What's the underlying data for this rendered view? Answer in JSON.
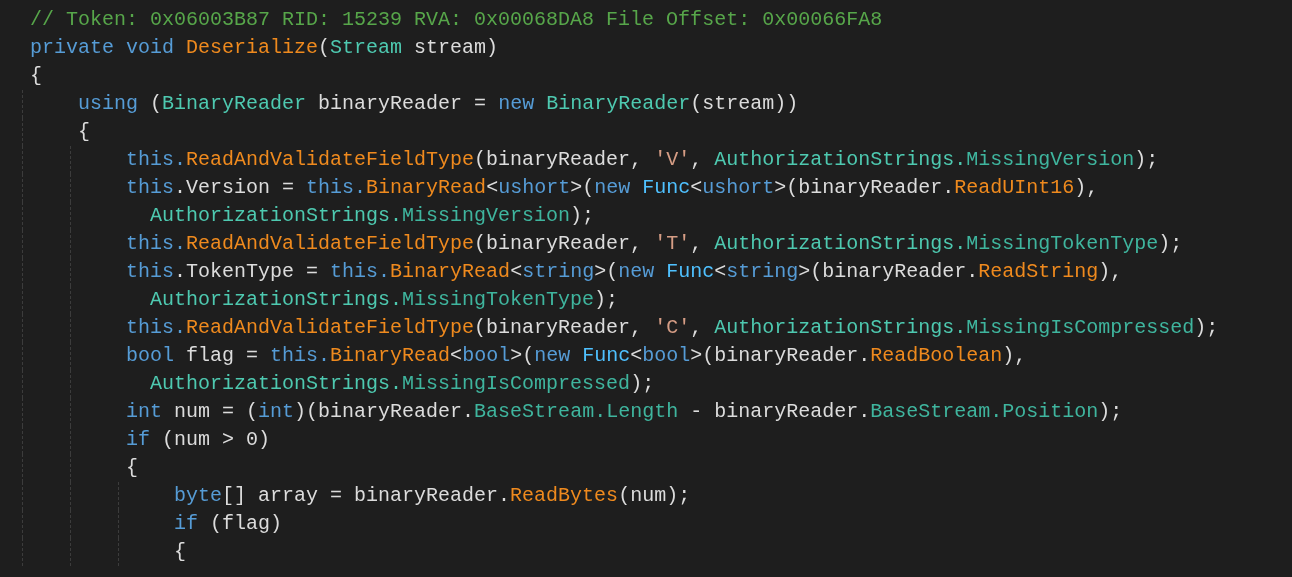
{
  "code_lines": [
    {
      "tokens": [
        {
          "text": "// Token: 0x06003B87 RID: 15239 RVA: 0x00068DA8 File Offset: 0x00066FA8",
          "kind": "comment"
        }
      ]
    },
    {
      "tokens": [
        {
          "text": "private void ",
          "kind": "keyword"
        },
        {
          "text": "Deserialize",
          "kind": "method"
        },
        {
          "text": "(",
          "kind": "plain"
        },
        {
          "text": "Stream",
          "kind": "type"
        },
        {
          "text": " stream)",
          "kind": "plain"
        }
      ]
    },
    {
      "tokens": [
        {
          "text": "{",
          "kind": "plain"
        }
      ]
    },
    {
      "tokens": [
        {
          "text": "    using",
          "kind": "keyword"
        },
        {
          "text": " (",
          "kind": "plain"
        },
        {
          "text": "BinaryReader",
          "kind": "type"
        },
        {
          "text": " binaryReader = ",
          "kind": "plain"
        },
        {
          "text": "new ",
          "kind": "keyword"
        },
        {
          "text": "BinaryReader",
          "kind": "type"
        },
        {
          "text": "(stream))",
          "kind": "plain"
        }
      ]
    },
    {
      "tokens": [
        {
          "text": "    {",
          "kind": "plain"
        }
      ]
    },
    {
      "tokens": [
        {
          "text": "        this.",
          "kind": "keyword"
        },
        {
          "text": "ReadAndValidateFieldType",
          "kind": "method"
        },
        {
          "text": "(binaryReader, ",
          "kind": "plain"
        },
        {
          "text": "'V'",
          "kind": "char"
        },
        {
          "text": ", ",
          "kind": "plain"
        },
        {
          "text": "AuthorizationStrings.",
          "kind": "type"
        },
        {
          "text": "MissingVersion",
          "kind": "member"
        },
        {
          "text": ");",
          "kind": "plain"
        }
      ]
    },
    {
      "tokens": [
        {
          "text": "        this",
          "kind": "keyword"
        },
        {
          "text": ".Version = ",
          "kind": "plain"
        },
        {
          "text": "this.",
          "kind": "keyword"
        },
        {
          "text": "BinaryRead",
          "kind": "method"
        },
        {
          "text": "<",
          "kind": "plain"
        },
        {
          "text": "ushort",
          "kind": "keyword"
        },
        {
          "text": ">(",
          "kind": "plain"
        },
        {
          "text": "new ",
          "kind": "keyword"
        },
        {
          "text": "Func",
          "kind": "delegate"
        },
        {
          "text": "<",
          "kind": "plain"
        },
        {
          "text": "ushort",
          "kind": "keyword"
        },
        {
          "text": ">(binaryReader.",
          "kind": "plain"
        },
        {
          "text": "ReadUInt16",
          "kind": "method"
        },
        {
          "text": "),",
          "kind": "plain"
        }
      ]
    },
    {
      "tokens": [
        {
          "text": "          AuthorizationStrings.",
          "kind": "type"
        },
        {
          "text": "MissingVersion",
          "kind": "member"
        },
        {
          "text": ");",
          "kind": "plain"
        }
      ]
    },
    {
      "tokens": [
        {
          "text": "        this.",
          "kind": "keyword"
        },
        {
          "text": "ReadAndValidateFieldType",
          "kind": "method"
        },
        {
          "text": "(binaryReader, ",
          "kind": "plain"
        },
        {
          "text": "'T'",
          "kind": "char"
        },
        {
          "text": ", ",
          "kind": "plain"
        },
        {
          "text": "AuthorizationStrings.",
          "kind": "type"
        },
        {
          "text": "MissingTokenType",
          "kind": "member"
        },
        {
          "text": ");",
          "kind": "plain"
        }
      ]
    },
    {
      "tokens": [
        {
          "text": "        this",
          "kind": "keyword"
        },
        {
          "text": ".TokenType = ",
          "kind": "plain"
        },
        {
          "text": "this.",
          "kind": "keyword"
        },
        {
          "text": "BinaryRead",
          "kind": "method"
        },
        {
          "text": "<",
          "kind": "plain"
        },
        {
          "text": "string",
          "kind": "keyword"
        },
        {
          "text": ">(",
          "kind": "plain"
        },
        {
          "text": "new ",
          "kind": "keyword"
        },
        {
          "text": "Func",
          "kind": "delegate"
        },
        {
          "text": "<",
          "kind": "plain"
        },
        {
          "text": "string",
          "kind": "keyword"
        },
        {
          "text": ">(binaryReader.",
          "kind": "plain"
        },
        {
          "text": "ReadString",
          "kind": "method"
        },
        {
          "text": "),",
          "kind": "plain"
        }
      ]
    },
    {
      "tokens": [
        {
          "text": "          AuthorizationStrings.",
          "kind": "type"
        },
        {
          "text": "MissingTokenType",
          "kind": "member"
        },
        {
          "text": ");",
          "kind": "plain"
        }
      ]
    },
    {
      "tokens": [
        {
          "text": "        this.",
          "kind": "keyword"
        },
        {
          "text": "ReadAndValidateFieldType",
          "kind": "method"
        },
        {
          "text": "(binaryReader, ",
          "kind": "plain"
        },
        {
          "text": "'C'",
          "kind": "char"
        },
        {
          "text": ", ",
          "kind": "plain"
        },
        {
          "text": "AuthorizationStrings.",
          "kind": "type"
        },
        {
          "text": "MissingIsCompressed",
          "kind": "member"
        },
        {
          "text": ");",
          "kind": "plain"
        }
      ]
    },
    {
      "tokens": [
        {
          "text": "        bool",
          "kind": "keyword"
        },
        {
          "text": " flag = ",
          "kind": "plain"
        },
        {
          "text": "this.",
          "kind": "keyword"
        },
        {
          "text": "BinaryRead",
          "kind": "method"
        },
        {
          "text": "<",
          "kind": "plain"
        },
        {
          "text": "bool",
          "kind": "keyword"
        },
        {
          "text": ">(",
          "kind": "plain"
        },
        {
          "text": "new ",
          "kind": "keyword"
        },
        {
          "text": "Func",
          "kind": "delegate"
        },
        {
          "text": "<",
          "kind": "plain"
        },
        {
          "text": "bool",
          "kind": "keyword"
        },
        {
          "text": ">(binaryReader.",
          "kind": "plain"
        },
        {
          "text": "ReadBoolean",
          "kind": "method"
        },
        {
          "text": "),",
          "kind": "plain"
        }
      ]
    },
    {
      "tokens": [
        {
          "text": "          AuthorizationStrings.",
          "kind": "type"
        },
        {
          "text": "MissingIsCompressed",
          "kind": "member"
        },
        {
          "text": ");",
          "kind": "plain"
        }
      ]
    },
    {
      "tokens": [
        {
          "text": "        int",
          "kind": "keyword"
        },
        {
          "text": " num = (",
          "kind": "plain"
        },
        {
          "text": "int",
          "kind": "keyword"
        },
        {
          "text": ")(binaryReader.",
          "kind": "plain"
        },
        {
          "text": "BaseStream.",
          "kind": "member"
        },
        {
          "text": "Length",
          "kind": "member"
        },
        {
          "text": " - binaryReader.",
          "kind": "plain"
        },
        {
          "text": "BaseStream.",
          "kind": "member"
        },
        {
          "text": "Position",
          "kind": "member"
        },
        {
          "text": ");",
          "kind": "plain"
        }
      ]
    },
    {
      "tokens": [
        {
          "text": "        if",
          "kind": "keyword"
        },
        {
          "text": " (num > 0)",
          "kind": "plain"
        }
      ]
    },
    {
      "tokens": [
        {
          "text": "        {",
          "kind": "plain"
        }
      ]
    },
    {
      "tokens": [
        {
          "text": "            byte",
          "kind": "keyword"
        },
        {
          "text": "[] array = binaryReader.",
          "kind": "plain"
        },
        {
          "text": "ReadBytes",
          "kind": "method"
        },
        {
          "text": "(num);",
          "kind": "plain"
        }
      ]
    },
    {
      "tokens": [
        {
          "text": "            if",
          "kind": "keyword"
        },
        {
          "text": " (flag)",
          "kind": "plain"
        }
      ]
    },
    {
      "tokens": [
        {
          "text": "            {",
          "kind": "plain"
        }
      ]
    }
  ]
}
